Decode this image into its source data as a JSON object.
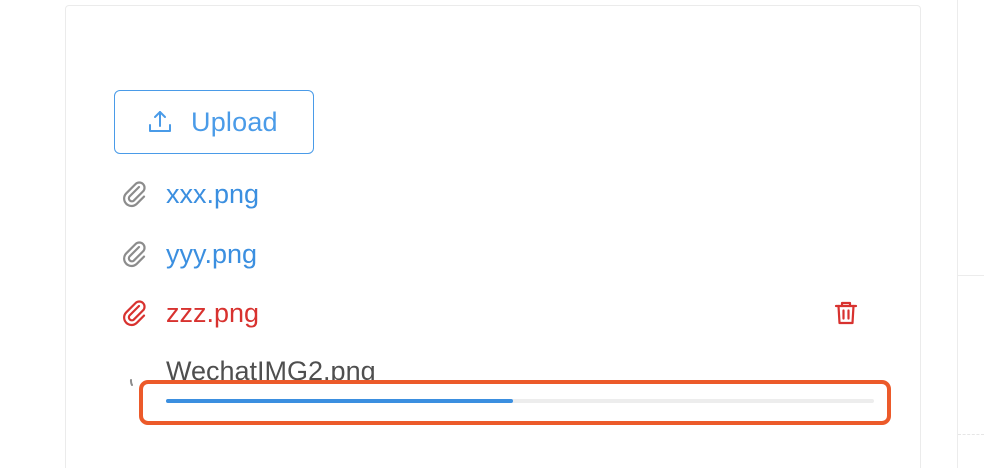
{
  "upload": {
    "button_label": "Upload",
    "icon": "upload-icon"
  },
  "files": [
    {
      "name": "xxx.png",
      "status": "done",
      "icon": "paperclip-icon"
    },
    {
      "name": "yyy.png",
      "status": "done",
      "icon": "paperclip-icon"
    },
    {
      "name": "zzz.png",
      "status": "error",
      "icon": "paperclip-icon",
      "action_icon": "trash-icon"
    }
  ],
  "uploading": {
    "name": "WechatIMG2.png",
    "status": "uploading",
    "icon": "loading-icon",
    "progress": 0.49
  },
  "colors": {
    "primary": "#3b8fe0",
    "error": "#d8322f",
    "highlight": "#ec5a2a",
    "track": "#ededed"
  }
}
